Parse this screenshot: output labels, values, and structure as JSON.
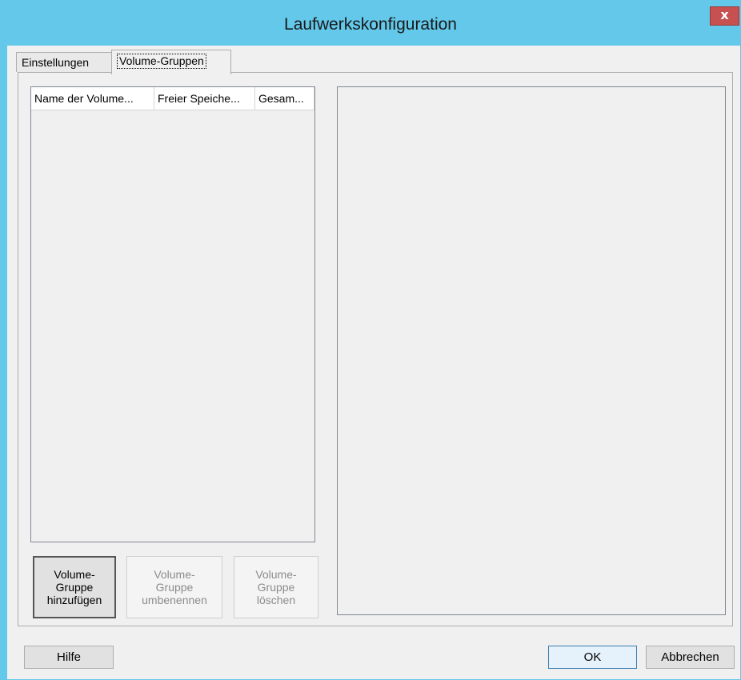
{
  "window": {
    "title": "Laufwerkskonfiguration",
    "close_label": "x"
  },
  "tabs": [
    {
      "label": "Einstellungen",
      "active": false
    },
    {
      "label": "Volume-Gruppen",
      "active": true
    }
  ],
  "volume_list": {
    "columns": [
      "Name der Volume...",
      "Freier Speiche...",
      "Gesam..."
    ],
    "rows": []
  },
  "volume_buttons": {
    "add": [
      "Volume-",
      "Gruppe",
      "hinzufügen"
    ],
    "rename": [
      "Volume-",
      "Gruppe",
      "umbenennen"
    ],
    "delete": [
      "Volume-",
      "Gruppe",
      "löschen"
    ]
  },
  "footer": {
    "help": "Hilfe",
    "ok": "OK",
    "cancel": "Abbrechen"
  },
  "colors": {
    "titlebar": "#63c8ea",
    "close": "#c75050"
  }
}
